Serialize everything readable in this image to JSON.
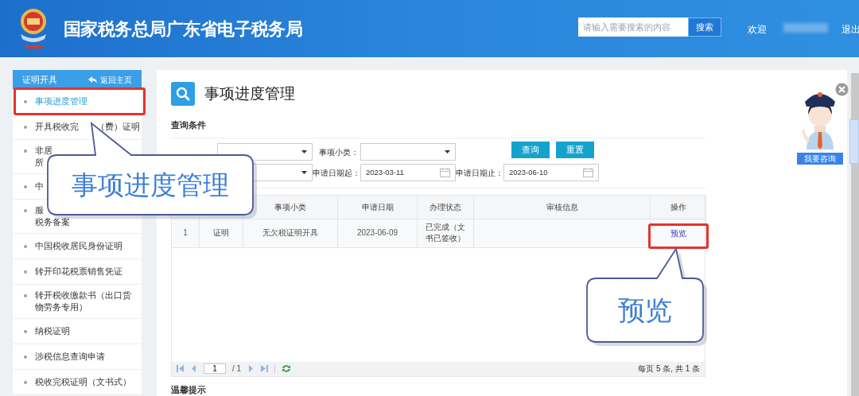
{
  "header": {
    "title": "国家税务总局广东省电子税务局",
    "search": {
      "placeholder": "请输入需要搜索的内容",
      "button": "搜索"
    },
    "welcome": "欢迎",
    "logout": "退出"
  },
  "sidebar": {
    "title": "证明开具",
    "back_link": "返回主页",
    "items": [
      {
        "lines": [
          [
            "事项进度管理"
          ]
        ],
        "selected": true
      },
      {
        "lines": [
          [
            "开具税收完",
            "（费）证明"
          ]
        ],
        "selected": false
      },
      {
        "lines": [
          [
            "非居"
          ],
          [
            "所"
          ]
        ],
        "selected": false
      },
      {
        "lines": [
          [
            "中"
          ]
        ],
        "selected": false
      },
      {
        "lines": [
          [
            "服"
          ],
          [
            "税务备案"
          ]
        ],
        "selected": false
      },
      {
        "lines": [
          [
            "中国税收居民身份证明"
          ]
        ],
        "selected": false
      },
      {
        "lines": [
          [
            "转开印花税票销售凭证"
          ]
        ],
        "selected": false
      },
      {
        "lines": [
          [
            "转开税收缴款书（出口货"
          ],
          [
            "物劳务专用）"
          ]
        ],
        "selected": false
      },
      {
        "lines": [
          [
            "纳税证明"
          ]
        ],
        "selected": false
      },
      {
        "lines": [
          [
            "涉税信息查询申请"
          ]
        ],
        "selected": false
      },
      {
        "lines": [
          [
            "税收完税证明（文书式）"
          ]
        ],
        "selected": false
      }
    ]
  },
  "page_title": "事项进度管理",
  "query": {
    "heading": "查询条件",
    "rows": [
      [
        {
          "kind": "select"
        },
        {
          "kind": "select",
          "label": "事项小类："
        }
      ],
      [
        {
          "kind": "select"
        },
        {
          "kind": "date",
          "label": "申请日期起：",
          "value": "2023-03-11"
        },
        {
          "kind": "date",
          "label": "申请日期止：",
          "value": "2023-06-10"
        }
      ]
    ],
    "buttons": [
      "查询",
      "重置"
    ]
  },
  "table": {
    "columns": [
      {},
      {},
      {
        "label": "事项小类"
      },
      {
        "label": "申请日期"
      },
      {
        "label": "办理状态"
      },
      {
        "label": "审核信息"
      },
      {
        "label": "操作"
      }
    ],
    "rows": [
      {
        "number": "1",
        "category": "证明",
        "subtype": "无欠税证明开具",
        "date": "2023-06-09",
        "status": "已完成（文书已签收）",
        "action": "预览"
      }
    ]
  },
  "pager": {
    "page": "1",
    "total": "/ 1",
    "summary": "每页 5 条, 共 1 条"
  },
  "tips_heading": "温馨提示",
  "assistant": {
    "button": "我要咨询"
  },
  "callouts": [
    {
      "text": "事项进度管理"
    },
    {
      "text": "预览"
    }
  ]
}
